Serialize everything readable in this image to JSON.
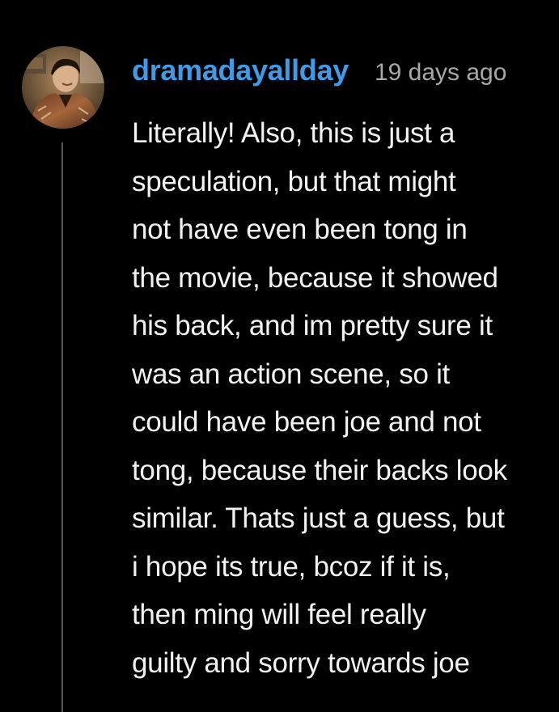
{
  "comment": {
    "avatar_icon": "user-avatar-photo",
    "username": "dramadayallday",
    "timestamp": "19 days ago",
    "body_lines": [
      "Literally! Also, this is just a",
      "speculation, but that might",
      "not have even been tong in",
      "the movie, because it showed",
      "his back, and im pretty sure it",
      "was an action scene, so it",
      "could have been joe and not",
      "tong, because their backs look",
      "similar. Thats just a guess, but",
      "i hope its true, bcoz if it is,",
      "then ming will feel really",
      "guilty and sorry towards joe"
    ]
  },
  "colors": {
    "background": "#000000",
    "username": "#3d9be9",
    "timestamp": "#a8a8a8",
    "text": "#f2f2f2",
    "thread_line": "#5a5a5a"
  }
}
